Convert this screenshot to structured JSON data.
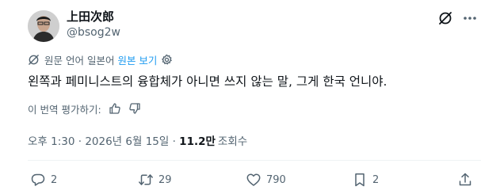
{
  "author": {
    "display_name": "上田次郎",
    "handle": "@bsog2w"
  },
  "translation": {
    "label": "원문 언어 일본어",
    "show_original": "원본 보기"
  },
  "tweet": {
    "text": "왼쪽과 페미니스트의 융합체가 아니면 쓰지 않는 말, 그게 한국 언니야."
  },
  "rate_translation": {
    "label": "이 번역 평가하기:"
  },
  "meta": {
    "timestamp": "오후 1:30 · 2026년 6월 15일 · ",
    "views_count": "11.2만",
    "views_label": "조회수"
  },
  "actions": {
    "replies": "2",
    "retweets": "29",
    "likes": "790",
    "bookmarks": "2"
  },
  "colors": {
    "text": "#0f1419",
    "secondary": "#536471",
    "accent": "#1d9bf0",
    "divider": "#eff3f4"
  },
  "icons": [
    "grok-icon",
    "more-icon",
    "translate-icon",
    "settings-icon",
    "thumbs-up-icon",
    "thumbs-down-icon",
    "reply-icon",
    "retweet-icon",
    "like-icon",
    "bookmark-icon",
    "share-icon"
  ]
}
